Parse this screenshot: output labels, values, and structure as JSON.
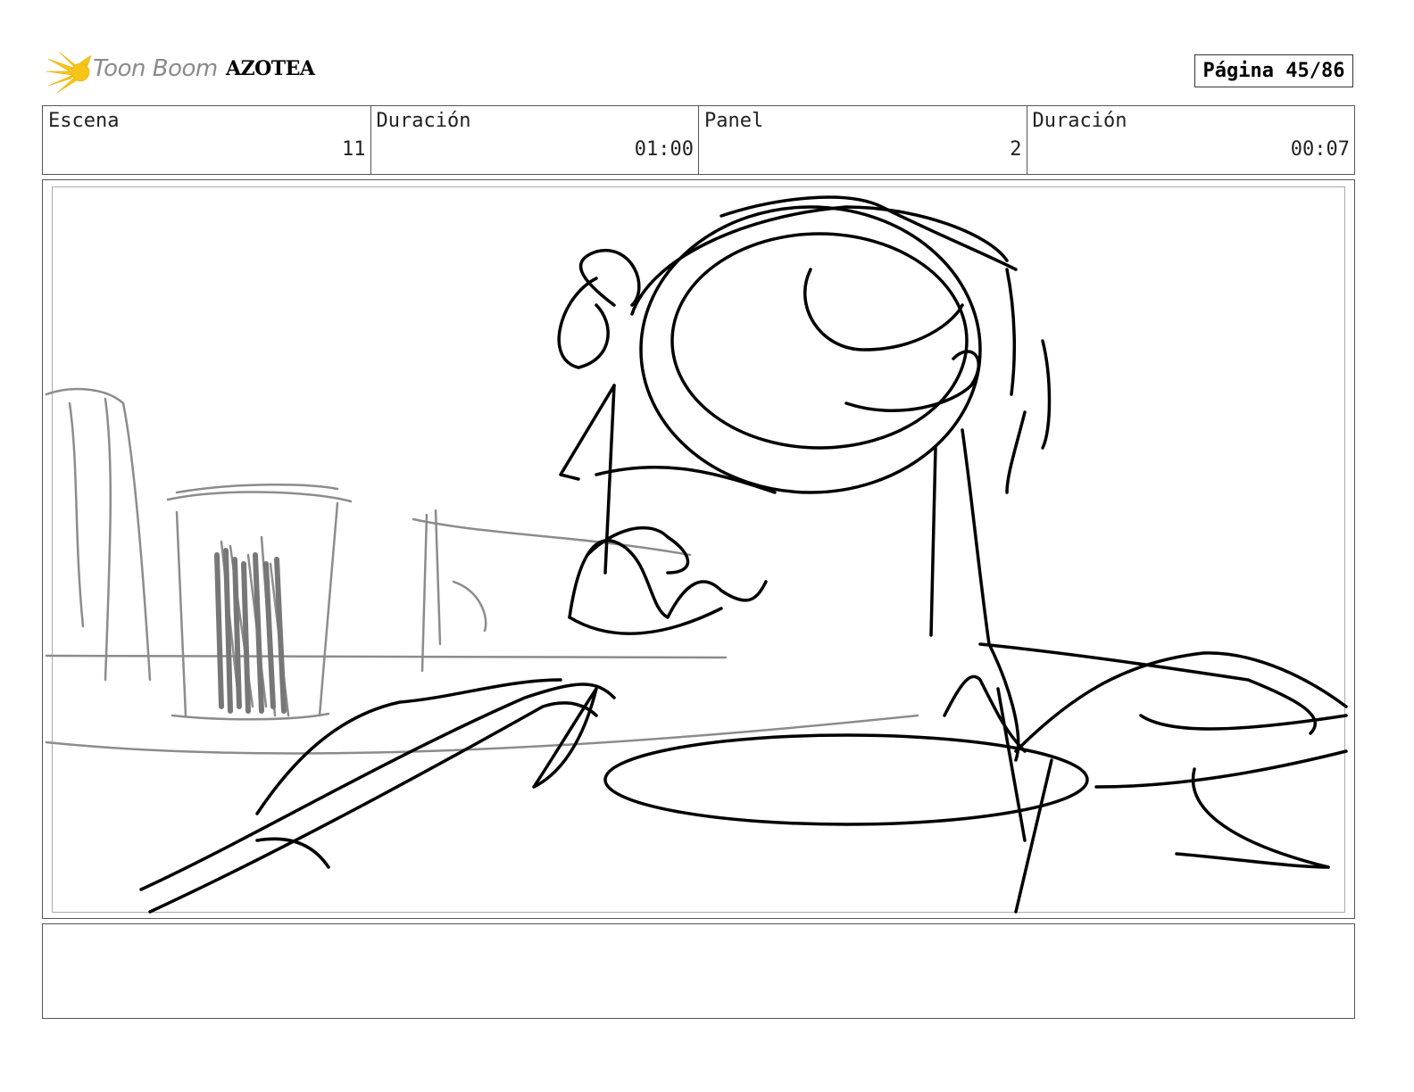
{
  "header": {
    "logo_text": "Toon Boom",
    "project_title": "AZOTEA",
    "page_label": "Página 45/86"
  },
  "info": {
    "scene": {
      "label": "Escena",
      "value": "11"
    },
    "scene_duration": {
      "label": "Duración",
      "value": "01:00"
    },
    "panel": {
      "label": "Panel",
      "value": "2"
    },
    "panel_duration": {
      "label": "Duración",
      "value": "00:07"
    }
  },
  "notes": {
    "text": ""
  },
  "colors": {
    "logo_star": "#f5c518",
    "sketch_primary": "#000000",
    "sketch_background": "#8c8c8c"
  },
  "icons": [
    "toon-boom-star-icon"
  ]
}
